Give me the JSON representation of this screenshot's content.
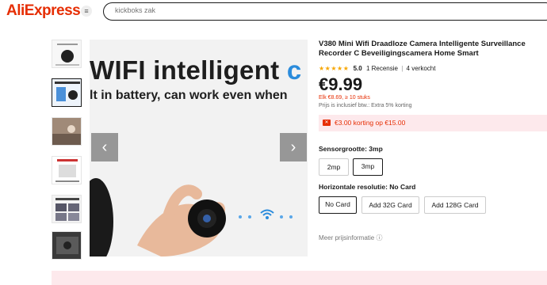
{
  "header": {
    "logo": "AliExpress",
    "search_placeholder": "kickboks zak"
  },
  "product": {
    "title": "V380 Mini Wifi Draadloze Camera Intelligente Surveillance Recorder C Beveiligingscamera Home Smart",
    "rating": "5.0",
    "reviews": "1 Recensie",
    "sold": "4 verkocht",
    "price": "€9.99",
    "sub_price": "Elk €8.69, ≥ 10 stuks",
    "tax_note": "Prijs is inclusief btw.: Extra 5% korting",
    "coupon": "€3.00 korting op €15.00"
  },
  "main_image": {
    "line1_a": "WIFI intelligent ",
    "line1_b": "c",
    "line2": "lt in battery, can work even when"
  },
  "options": {
    "sensor_label": "Sensorgrootte: 3mp",
    "sensor": [
      "2mp",
      "3mp"
    ],
    "sensor_selected": "3mp",
    "resolution_label": "Horizontale resolutie: No Card",
    "resolution": [
      "No Card",
      "Add 32G Card",
      "Add 128G Card"
    ],
    "resolution_selected": "No Card"
  },
  "more_price_info": "Meer prijsinformatie ⓘ",
  "colors": {
    "accent": "#e62e04",
    "star": "#f7a600",
    "coupon_bg": "#fde9ec"
  }
}
